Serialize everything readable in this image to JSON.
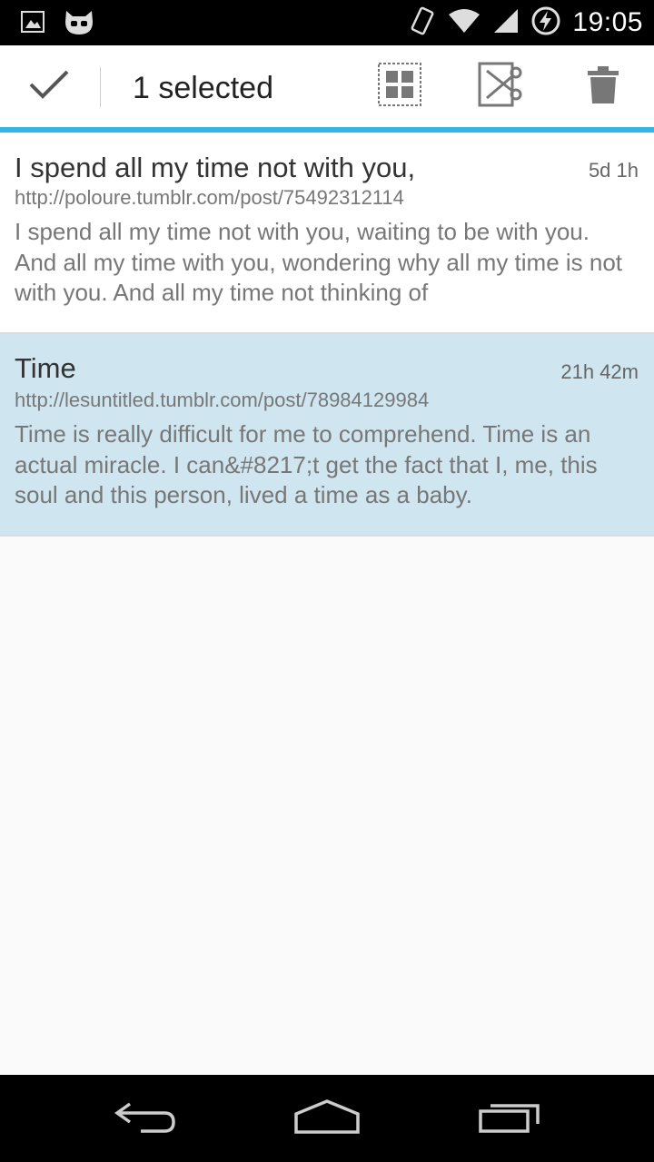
{
  "status_bar": {
    "time": "19:05",
    "left_icons": [
      "image-icon",
      "cyanogen-icon"
    ],
    "right_icons": [
      "rotate-icon",
      "wifi-icon",
      "signal-icon",
      "battery-charging-icon"
    ]
  },
  "action_bar": {
    "title": "1 selected",
    "actions": [
      "done-check-icon",
      "select-all-icon",
      "cut-icon",
      "delete-icon"
    ],
    "accent_color": "#33b5e5"
  },
  "items": [
    {
      "title": "I spend all my time not with you,",
      "time": "5d 1h",
      "url": "http://poloure.tumblr.com/post/75492312114",
      "body": "I spend all my time not with you, waiting to be with you.   And all my time with you, wondering why all my time is not with you.  And all my time not thinking of",
      "selected": false
    },
    {
      "title": "Time",
      "time": "21h 42m",
      "url": "http://lesuntitled.tumblr.com/post/78984129984",
      "body": "Time is really difficult for me to comprehend. Time is an actual miracle. I can&#8217;t get the fact that I, me, this soul and this person, lived a time as a baby.",
      "selected": true,
      "selected_color": "#cfe5ef"
    }
  ],
  "nav_bar": {
    "buttons": [
      "back-icon",
      "home-icon",
      "recent-apps-icon"
    ]
  }
}
